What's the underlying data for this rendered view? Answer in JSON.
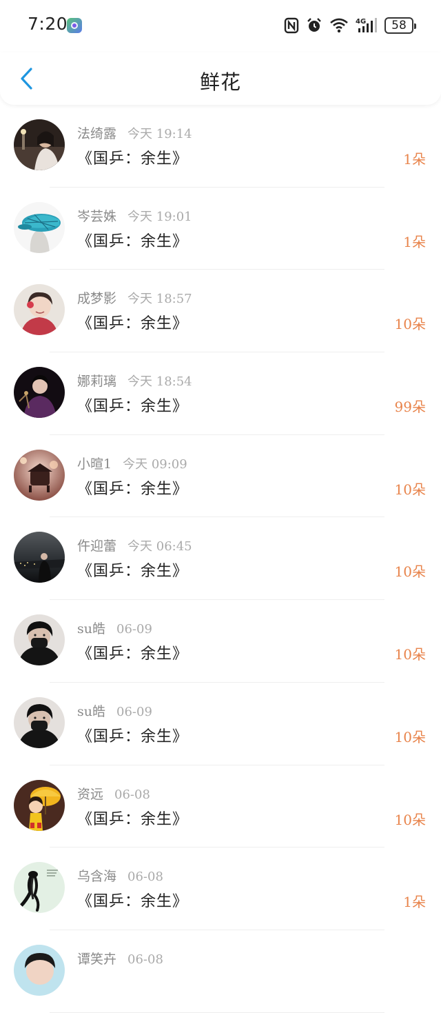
{
  "status_bar": {
    "time": "7:20",
    "network": "4G",
    "battery": "58"
  },
  "header": {
    "title": "鲜花"
  },
  "colors": {
    "accent": "#1e96e0",
    "amount": "#e8834a"
  },
  "rows": [
    {
      "name": "法绮露",
      "time": "今天 19:14",
      "book": "《国乒：余生》",
      "amount": "1朵"
    },
    {
      "name": "岑芸姝",
      "time": "今天 19:01",
      "book": "《国乒：余生》",
      "amount": "1朵"
    },
    {
      "name": "成梦影",
      "time": "今天 18:57",
      "book": "《国乒：余生》",
      "amount": "10朵"
    },
    {
      "name": "娜莉璃",
      "time": "今天 18:54",
      "book": "《国乒：余生》",
      "amount": "99朵"
    },
    {
      "name": "小暄1",
      "time": "今天 09:09",
      "book": "《国乒：余生》",
      "amount": "10朵"
    },
    {
      "name": "仵迎蕾",
      "time": "今天 06:45",
      "book": "《国乒：余生》",
      "amount": "10朵"
    },
    {
      "name": "su皓",
      "time": "06-09",
      "book": "《国乒：余生》",
      "amount": "10朵"
    },
    {
      "name": "su皓",
      "time": "06-09",
      "book": "《国乒：余生》",
      "amount": "10朵"
    },
    {
      "name": "资远",
      "time": "06-08",
      "book": "《国乒：余生》",
      "amount": "10朵"
    },
    {
      "name": "乌含海",
      "time": "06-08",
      "book": "《国乒：余生》",
      "amount": "1朵"
    },
    {
      "name": "谭笑卉",
      "time": "06-08",
      "book": "",
      "amount": ""
    }
  ]
}
